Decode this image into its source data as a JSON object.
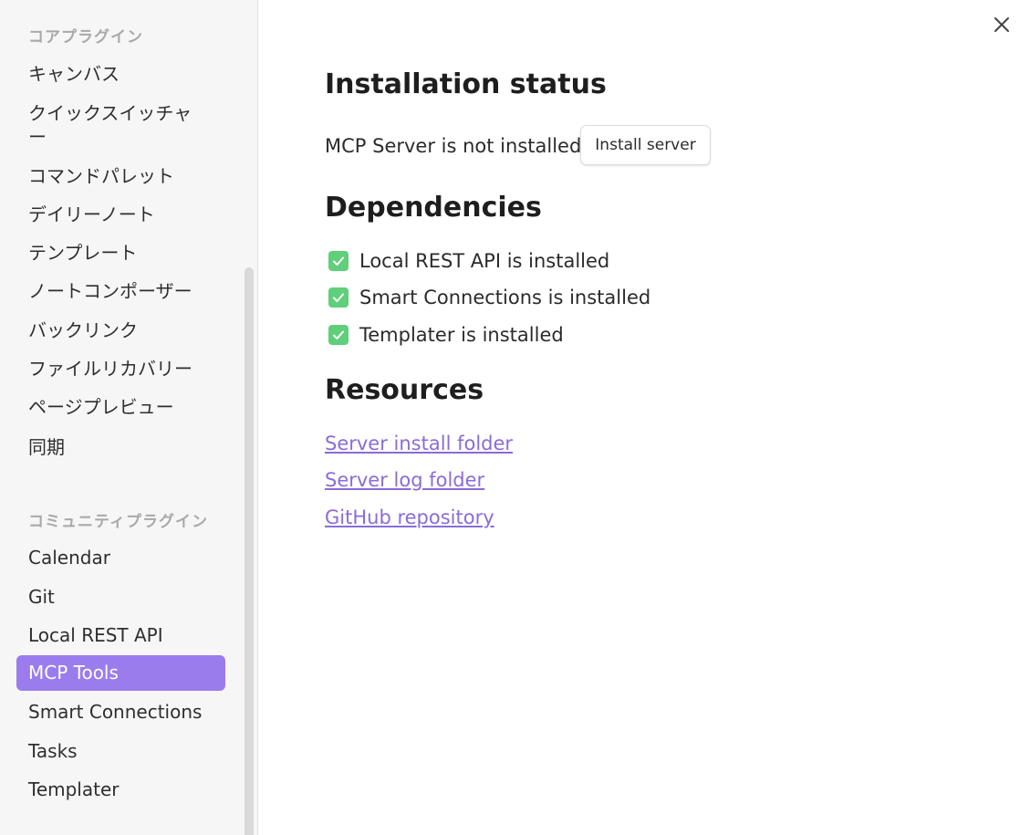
{
  "sidebar": {
    "core_heading": "コアプラグイン",
    "core_items": [
      {
        "label": "キャンバス"
      },
      {
        "label": "クイックスイッチャ\nー"
      },
      {
        "label": "コマンドパレット"
      },
      {
        "label": "デイリーノート"
      },
      {
        "label": "テンプレート"
      },
      {
        "label": "ノートコンポーザー"
      },
      {
        "label": "バックリンク"
      },
      {
        "label": "ファイルリカバリー"
      },
      {
        "label": "ページプレビュー"
      },
      {
        "label": "同期"
      }
    ],
    "community_heading": "コミュニティプラグイン",
    "community_items": [
      {
        "label": "Calendar"
      },
      {
        "label": "Git"
      },
      {
        "label": "Local REST API"
      },
      {
        "label": "MCP Tools",
        "active": true
      },
      {
        "label": "Smart Connections"
      },
      {
        "label": "Tasks"
      },
      {
        "label": "Templater"
      }
    ]
  },
  "main": {
    "installation": {
      "title": "Installation status",
      "status_text": "MCP Server is not installed",
      "install_button": "Install server"
    },
    "dependencies": {
      "title": "Dependencies",
      "items": [
        {
          "label": "Local REST API is installed",
          "icon": "check-icon"
        },
        {
          "label": "Smart Connections is installed",
          "icon": "check-icon"
        },
        {
          "label": "Templater is installed",
          "icon": "check-icon"
        }
      ]
    },
    "resources": {
      "title": "Resources",
      "links": [
        {
          "label": "Server install folder"
        },
        {
          "label": "Server log folder"
        },
        {
          "label": "GitHub repository"
        }
      ]
    }
  },
  "colors": {
    "accent": "#9b7ced",
    "link": "#8a6cd9",
    "check": "#5fcf7a"
  }
}
